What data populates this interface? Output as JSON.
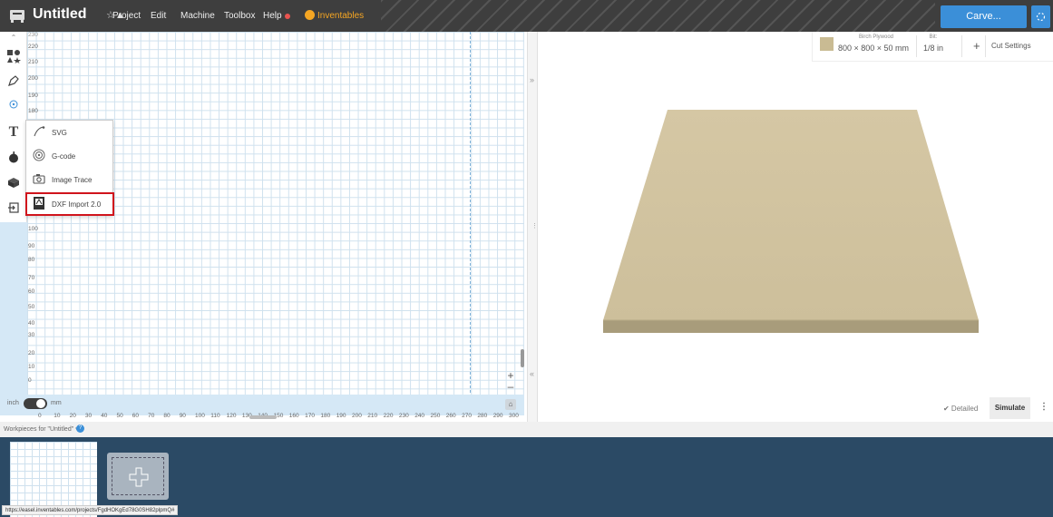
{
  "app": {
    "title": "Untitled",
    "menu": [
      "Project",
      "Edit",
      "Machine",
      "Toolbox",
      "Help"
    ],
    "brand": "Inventables",
    "carve_label": "Carve..."
  },
  "canvas": {
    "y_labels": [
      "230",
      "220",
      "210",
      "200",
      "190",
      "180",
      "100",
      "90",
      "80",
      "70",
      "60",
      "50",
      "40",
      "30",
      "20",
      "10",
      "0"
    ],
    "x_labels": [
      "0",
      "10",
      "20",
      "30",
      "40",
      "50",
      "60",
      "70",
      "80",
      "90",
      "100",
      "110",
      "120",
      "130",
      "140",
      "150",
      "160",
      "170",
      "180",
      "190",
      "200",
      "210",
      "220",
      "230",
      "240",
      "250",
      "260",
      "270",
      "280",
      "290",
      "300"
    ],
    "unit_left": "inch",
    "unit_right": "mm",
    "unit_selected": "mm"
  },
  "import_menu": {
    "items": [
      {
        "label": "SVG",
        "icon": "svg-pen-icon"
      },
      {
        "label": "G-code",
        "icon": "gcode-spiral-icon"
      },
      {
        "label": "Image Trace",
        "icon": "camera-icon"
      },
      {
        "label": "DXF Import 2.0",
        "icon": "dxf-file-icon",
        "highlighted": true
      }
    ]
  },
  "material": {
    "name": "Birch Plywood",
    "size": "800 × 800 × 50 mm",
    "bit_label": "Bit:",
    "bit_value": "1/8 in",
    "add": "+",
    "cut_settings": "Cut Settings",
    "swatch_color": "#c9bb93"
  },
  "preview": {
    "detailed": "✔ Detailed",
    "simulate": "Simulate"
  },
  "workpieces": {
    "label": "Workpieces for \"Untitled\" ▾",
    "help": "?"
  },
  "status": {
    "url": "https://easel.inventables.com/projects/FgdHOKgEd78G0SH82plpmQ#"
  },
  "colors": {
    "topbar": "#3e3e3e",
    "accent": "#3b8fd8",
    "workpieces_bg": "#2b4a65",
    "highlight": "#d0141c"
  }
}
